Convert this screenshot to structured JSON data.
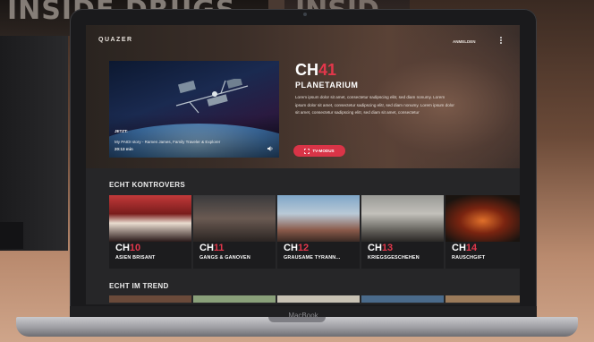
{
  "background": {
    "poster_left_title": "INSIDE DRUGS",
    "poster_right_title": "INSID"
  },
  "laptop": {
    "brand": "MacBook"
  },
  "app": {
    "logo": "QUAZER",
    "login_label": "ANMELDEN",
    "menu_icon": "more-vertical-icon",
    "accent_color": "#e2374b"
  },
  "hero": {
    "player": {
      "badge": "JETZT:",
      "now_playing": "My PAIDI story - Ramen James, Family Traveler & Explorer",
      "duration": "20:13 min",
      "volume_icon": "speaker-icon"
    },
    "channel_prefix": "CH",
    "channel_number": "41",
    "title": "PLANETARIUM",
    "description": "Lorem ipsum dolor sit amet, consectetur sadipscing elitr, sed diam nonumy. Lorem ipsum dolor sit amet, consectetur sadipscing elitr, sed diam nonumy. Lorem ipsum dolor sit amet, consectetur sadipscing elitr, sed diam sit amet, consectetur",
    "tv_button_label": "TV-MODUS",
    "tv_button_icon": "expand-icon"
  },
  "sections": [
    {
      "title": "ECHT KONTROVERS",
      "cards": [
        {
          "prefix": "CH",
          "number": "10",
          "name": "ASIEN BRISANT"
        },
        {
          "prefix": "CH",
          "number": "11",
          "name": "GANGS & GANOVEN"
        },
        {
          "prefix": "CH",
          "number": "12",
          "name": "GRAUSAME TYRANN..."
        },
        {
          "prefix": "CH",
          "number": "13",
          "name": "KRIEGSGESCHEHEN"
        },
        {
          "prefix": "CH",
          "number": "14",
          "name": "RAUSCHGIFT"
        }
      ]
    },
    {
      "title": "ECHT IM TREND"
    }
  ]
}
